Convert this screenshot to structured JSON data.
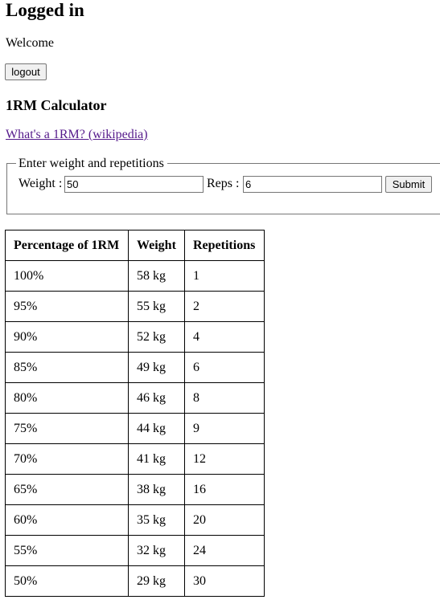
{
  "header": {
    "title": "Logged in",
    "welcome": "Welcome",
    "logout_label": "logout"
  },
  "calculator": {
    "title": "1RM Calculator",
    "wiki_link": "What's a 1RM? (wikipedia)",
    "form": {
      "legend": "Enter weight and repetitions",
      "weight_label": "Weight :",
      "weight_value": "50",
      "reps_label": "Reps :",
      "reps_value": "6",
      "submit_label": "Submit"
    }
  },
  "table": {
    "headers": [
      "Percentage of 1RM",
      "Weight",
      "Repetitions"
    ],
    "rows": [
      [
        "100%",
        "58 kg",
        "1"
      ],
      [
        "95%",
        "55 kg",
        "2"
      ],
      [
        "90%",
        "52 kg",
        "4"
      ],
      [
        "85%",
        "49 kg",
        "6"
      ],
      [
        "80%",
        "46 kg",
        "8"
      ],
      [
        "75%",
        "44 kg",
        "9"
      ],
      [
        "70%",
        "41 kg",
        "12"
      ],
      [
        "65%",
        "38 kg",
        "16"
      ],
      [
        "60%",
        "35 kg",
        "20"
      ],
      [
        "55%",
        "32 kg",
        "24"
      ],
      [
        "50%",
        "29 kg",
        "30"
      ]
    ]
  }
}
